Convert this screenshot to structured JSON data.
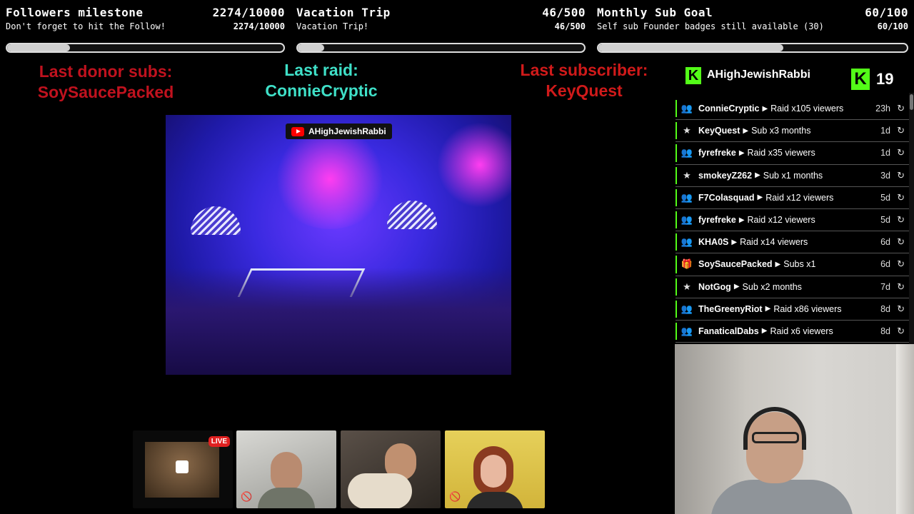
{
  "goals": [
    {
      "title": "Followers milestone",
      "count": "2274/10000",
      "subtitle": "Don't forget to hit the Follow!",
      "count2": "2274/10000",
      "progress": 0.227
    },
    {
      "title": "Vacation Trip",
      "count": "46/500",
      "subtitle": "Vacation Trip!",
      "count2": "46/500",
      "progress": 0.092
    },
    {
      "title": "Monthly Sub Goal",
      "count": "60/100",
      "subtitle": "Self sub Founder badges still available (30)",
      "count2": "60/100",
      "progress": 0.6
    }
  ],
  "alerts": {
    "donor": {
      "label": "Last donor subs:",
      "name": "SoySaucePacked",
      "color": "#c0121e"
    },
    "raid": {
      "label": "Last raid:",
      "name": "ConnieCryptic",
      "color": "#3fe0c8"
    },
    "subscriber": {
      "label": "Last subscriber:",
      "name": "KeyQuest",
      "color": "#d01a1a"
    }
  },
  "video": {
    "channel": "AHighJewishRabbi"
  },
  "thumbnails": {
    "live_label": "LIVE"
  },
  "panel": {
    "username": "AHighJewishRabbi",
    "viewers": "19",
    "brand_color": "#53fc18"
  },
  "events": [
    {
      "icon": "raid",
      "name": "ConnieCryptic",
      "action": "Raid x105 viewers",
      "time": "23h"
    },
    {
      "icon": "star",
      "name": "KeyQuest",
      "action": "Sub x3 months",
      "time": "1d"
    },
    {
      "icon": "raid",
      "name": "fyrefreke",
      "action": "Raid x35 viewers",
      "time": "1d"
    },
    {
      "icon": "star",
      "name": "smokeyZ262",
      "action": "Sub x1 months",
      "time": "3d"
    },
    {
      "icon": "raid",
      "name": "F7Colasquad",
      "action": "Raid x12 viewers",
      "time": "5d"
    },
    {
      "icon": "raid",
      "name": "fyrefreke",
      "action": "Raid x12 viewers",
      "time": "5d"
    },
    {
      "icon": "raid",
      "name": "KHA0S",
      "action": "Raid x14 viewers",
      "time": "6d"
    },
    {
      "icon": "gift",
      "name": "SoySaucePacked",
      "action": "Subs x1",
      "time": "6d"
    },
    {
      "icon": "star",
      "name": "NotGog",
      "action": "Sub x2 months",
      "time": "7d"
    },
    {
      "icon": "raid",
      "name": "TheGreenyRiot",
      "action": "Raid x86 viewers",
      "time": "8d"
    },
    {
      "icon": "raid",
      "name": "FanaticalDabs",
      "action": "Raid x6 viewers",
      "time": "8d"
    }
  ]
}
